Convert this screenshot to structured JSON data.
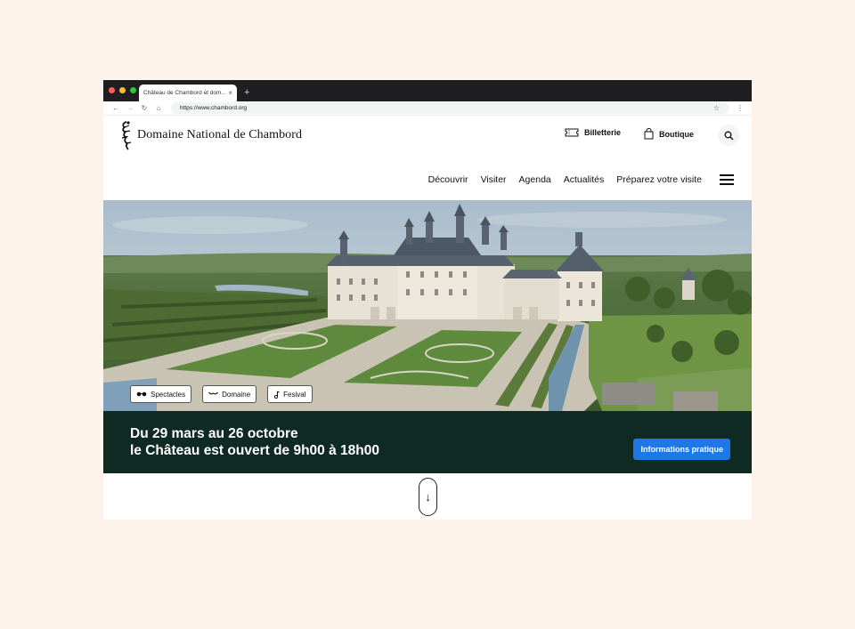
{
  "browser": {
    "tab_title": "Château de Chambord et dom...",
    "tab_close": "×",
    "new_tab": "+",
    "url": "https://www.chambord.org",
    "colors": {
      "red": "#ff5f57",
      "yellow": "#febc2e",
      "green": "#28c840"
    }
  },
  "header": {
    "site_title": "Domaine National de Chambord",
    "billetterie": "Billetterie",
    "boutique": "Boutique"
  },
  "nav": {
    "items": [
      "Découvrir",
      "Visiter",
      "Agenda",
      "Actualités",
      "Préparez votre visite"
    ]
  },
  "hero": {
    "chips": [
      {
        "label": "Spectacles",
        "icon": "glasses-icon"
      },
      {
        "label": "Domaine",
        "icon": "landscape-icon"
      },
      {
        "label": "Fesival",
        "icon": "music-note-icon"
      }
    ]
  },
  "banner": {
    "line1": "Du 29 mars au 26 octobre",
    "line2": "le Château est ouvert de 9h00 à 18h00",
    "button": "Informations pratique",
    "bg_color": "#0e2a22",
    "button_color": "#1e78e6"
  },
  "scroll": {
    "arrow": "↓"
  }
}
